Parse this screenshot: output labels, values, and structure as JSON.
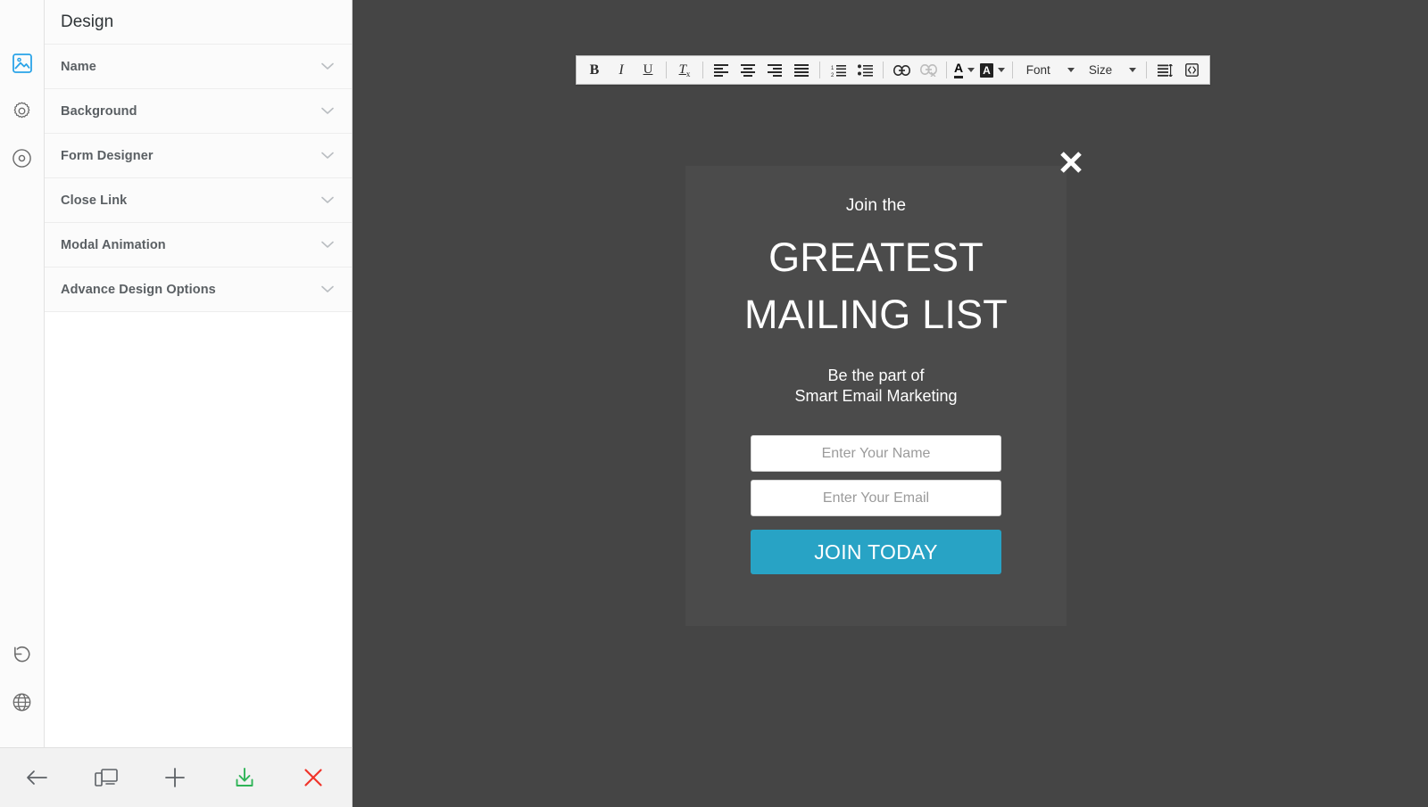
{
  "panel": {
    "title": "Design",
    "accordion": [
      {
        "label": "Name",
        "icon": "chevron-down-icon"
      },
      {
        "label": "Background",
        "icon": "chevron-down-icon"
      },
      {
        "label": "Form Designer",
        "icon": "chevron-down-icon"
      },
      {
        "label": "Close Link",
        "icon": "chevron-down-icon"
      },
      {
        "label": "Modal Animation",
        "icon": "chevron-down-icon"
      },
      {
        "label": "Advance Design Options",
        "icon": "chevron-down-icon"
      }
    ]
  },
  "rail": {
    "top_items": [
      {
        "icon": "image-icon",
        "name": "design-tab",
        "active": true
      },
      {
        "icon": "gear-icon",
        "name": "settings-tab",
        "active": false
      },
      {
        "icon": "target-icon",
        "name": "targeting-tab",
        "active": false
      }
    ],
    "bottom_items": [
      {
        "icon": "history-undo-icon",
        "name": "revision-history"
      },
      {
        "icon": "globe-icon",
        "name": "publish-site"
      }
    ]
  },
  "bottom_toolbar": {
    "buttons": [
      {
        "icon": "arrow-left-icon",
        "name": "back-button",
        "color": "#5d6166"
      },
      {
        "icon": "responsive-devices-icon",
        "name": "device-preview-button",
        "color": "#5d6166"
      },
      {
        "icon": "plus-icon",
        "name": "add-button",
        "color": "#5d6166"
      },
      {
        "icon": "download-save-icon",
        "name": "save-button",
        "color": "#2fb457"
      },
      {
        "icon": "close-x-icon",
        "name": "discard-button",
        "color": "#f0342a"
      }
    ]
  },
  "rte_toolbar": {
    "items": [
      {
        "type": "button",
        "name": "bold",
        "glyph": "B"
      },
      {
        "type": "button",
        "name": "italic",
        "glyph": "I"
      },
      {
        "type": "button",
        "name": "underline",
        "glyph": "U"
      },
      {
        "type": "separator"
      },
      {
        "type": "button",
        "name": "remove-format",
        "glyph": "Tx"
      },
      {
        "type": "separator"
      },
      {
        "type": "button",
        "name": "align-left",
        "glyph": "align-left-icon"
      },
      {
        "type": "button",
        "name": "align-center",
        "glyph": "align-center-icon"
      },
      {
        "type": "button",
        "name": "align-right",
        "glyph": "align-right-icon"
      },
      {
        "type": "button",
        "name": "align-justify",
        "glyph": "align-justify-icon"
      },
      {
        "type": "separator"
      },
      {
        "type": "button",
        "name": "ordered-list",
        "glyph": "numbered-list-icon"
      },
      {
        "type": "button",
        "name": "unordered-list",
        "glyph": "bullet-list-icon"
      },
      {
        "type": "separator"
      },
      {
        "type": "button",
        "name": "insert-link",
        "glyph": "link-icon"
      },
      {
        "type": "button",
        "name": "unlink",
        "glyph": "unlink-icon",
        "disabled": true
      },
      {
        "type": "separator"
      },
      {
        "type": "split",
        "name": "text-color",
        "glyph": "font-color-icon"
      },
      {
        "type": "split",
        "name": "highlight-color",
        "glyph": "highlight-color-icon"
      },
      {
        "type": "separator"
      },
      {
        "type": "dropdown",
        "name": "font-family",
        "label": "Font"
      },
      {
        "type": "dropdown",
        "name": "font-size",
        "label": "Size"
      },
      {
        "type": "separator"
      },
      {
        "type": "button",
        "name": "line-height",
        "glyph": "line-height-icon"
      },
      {
        "type": "button",
        "name": "source-code",
        "glyph": "source-code-icon"
      }
    ],
    "font_label": "Font",
    "size_label": "Size"
  },
  "modal": {
    "close_icon": "close-x-icon",
    "pretitle": "Join the",
    "heading_line1": "GREATEST",
    "heading_line2": "MAILING LIST",
    "sub_line1": "Be the part of",
    "sub_line2": "Smart Email Marketing",
    "name_placeholder": "Enter Your Name",
    "email_placeholder": "Enter Your Email",
    "cta_label": "JOIN TODAY",
    "cta_color": "#28a3c5",
    "modal_bg": "#4b4b4b",
    "canvas_bg": "#454545"
  }
}
